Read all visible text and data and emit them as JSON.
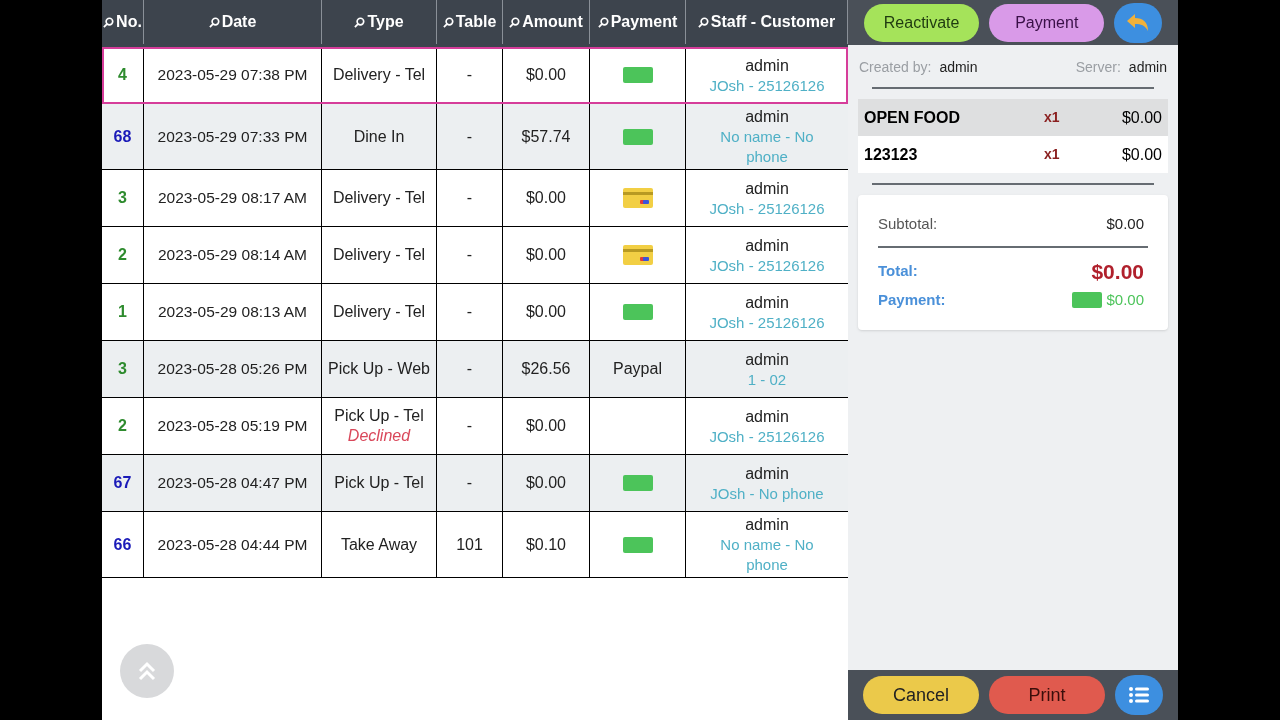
{
  "table": {
    "columns": [
      "No.",
      "Date",
      "Type",
      "Table",
      "Amount",
      "Payment",
      "Staff - Customer"
    ],
    "rows": [
      {
        "no": "4",
        "color": "#2e8b2e",
        "date": "2023-05-29 07:38 PM",
        "type": "Delivery - Tel",
        "table": "-",
        "amount": "$0.00",
        "payment": {
          "kind": "cash"
        },
        "staff": "admin",
        "customer": "JOsh - 25126126",
        "selected": true,
        "shaded": false
      },
      {
        "no": "68",
        "color": "#1a1ab8",
        "date": "2023-05-29 07:33 PM",
        "type": "Dine In",
        "table": "-",
        "amount": "$57.74",
        "payment": {
          "kind": "cash"
        },
        "staff": "admin",
        "customer": "No name - No phone",
        "selected": false,
        "shaded": true
      },
      {
        "no": "3",
        "color": "#2e8b2e",
        "date": "2023-05-29 08:17 AM",
        "type": "Delivery - Tel",
        "table": "-",
        "amount": "$0.00",
        "payment": {
          "kind": "card"
        },
        "staff": "admin",
        "customer": "JOsh - 25126126",
        "selected": false,
        "shaded": false
      },
      {
        "no": "2",
        "color": "#2e8b2e",
        "date": "2023-05-29 08:14 AM",
        "type": "Delivery - Tel",
        "table": "-",
        "amount": "$0.00",
        "payment": {
          "kind": "card"
        },
        "staff": "admin",
        "customer": "JOsh - 25126126",
        "selected": false,
        "shaded": false
      },
      {
        "no": "1",
        "color": "#2e8b2e",
        "date": "2023-05-29 08:13 AM",
        "type": "Delivery - Tel",
        "table": "-",
        "amount": "$0.00",
        "payment": {
          "kind": "cash"
        },
        "staff": "admin",
        "customer": "JOsh - 25126126",
        "selected": false,
        "shaded": false
      },
      {
        "no": "3",
        "color": "#2e8b2e",
        "date": "2023-05-28 05:26 PM",
        "type": "Pick Up - Web",
        "table": "-",
        "amount": "$26.56",
        "payment": {
          "kind": "text",
          "label": "Paypal"
        },
        "staff": "admin",
        "customer": "1 - 02",
        "selected": false,
        "shaded": true
      },
      {
        "no": "2",
        "color": "#2e8b2e",
        "date": "2023-05-28 05:19 PM",
        "type": "Pick Up - Tel",
        "status": "Declined",
        "table": "-",
        "amount": "$0.00",
        "payment": {
          "kind": "none"
        },
        "staff": "admin",
        "customer": "JOsh - 25126126",
        "selected": false,
        "shaded": false
      },
      {
        "no": "67",
        "color": "#1a1ab8",
        "date": "2023-05-28 04:47 PM",
        "type": "Pick Up - Tel",
        "table": "-",
        "amount": "$0.00",
        "payment": {
          "kind": "cash"
        },
        "staff": "admin",
        "customer": "JOsh - No phone",
        "selected": false,
        "shaded": true
      },
      {
        "no": "66",
        "color": "#1a1ab8",
        "date": "2023-05-28 04:44 PM",
        "type": "Take Away",
        "table": "101",
        "amount": "$0.10",
        "payment": {
          "kind": "cash"
        },
        "staff": "admin",
        "customer": "No name - No phone",
        "selected": false,
        "shaded": false
      }
    ]
  },
  "panel": {
    "buttons": [
      "Reactivate",
      "Payment"
    ],
    "created_label": "Created by:",
    "created_value": "admin",
    "server_label": "Server:",
    "server_value": "admin",
    "items": [
      {
        "name": "OPEN FOOD",
        "qty": "x1",
        "price": "$0.00",
        "selected": true
      },
      {
        "name": "123123",
        "qty": "x1",
        "price": "$0.00",
        "selected": false
      }
    ],
    "subtotal_label": "Subtotal:",
    "subtotal": "$0.00",
    "total_label": "Total:",
    "total": "$0.00",
    "payment_label": "Payment:",
    "payment": {
      "kind": "cash",
      "amount": "$0.00"
    },
    "footer_buttons": [
      "Cancel",
      "Print"
    ]
  }
}
